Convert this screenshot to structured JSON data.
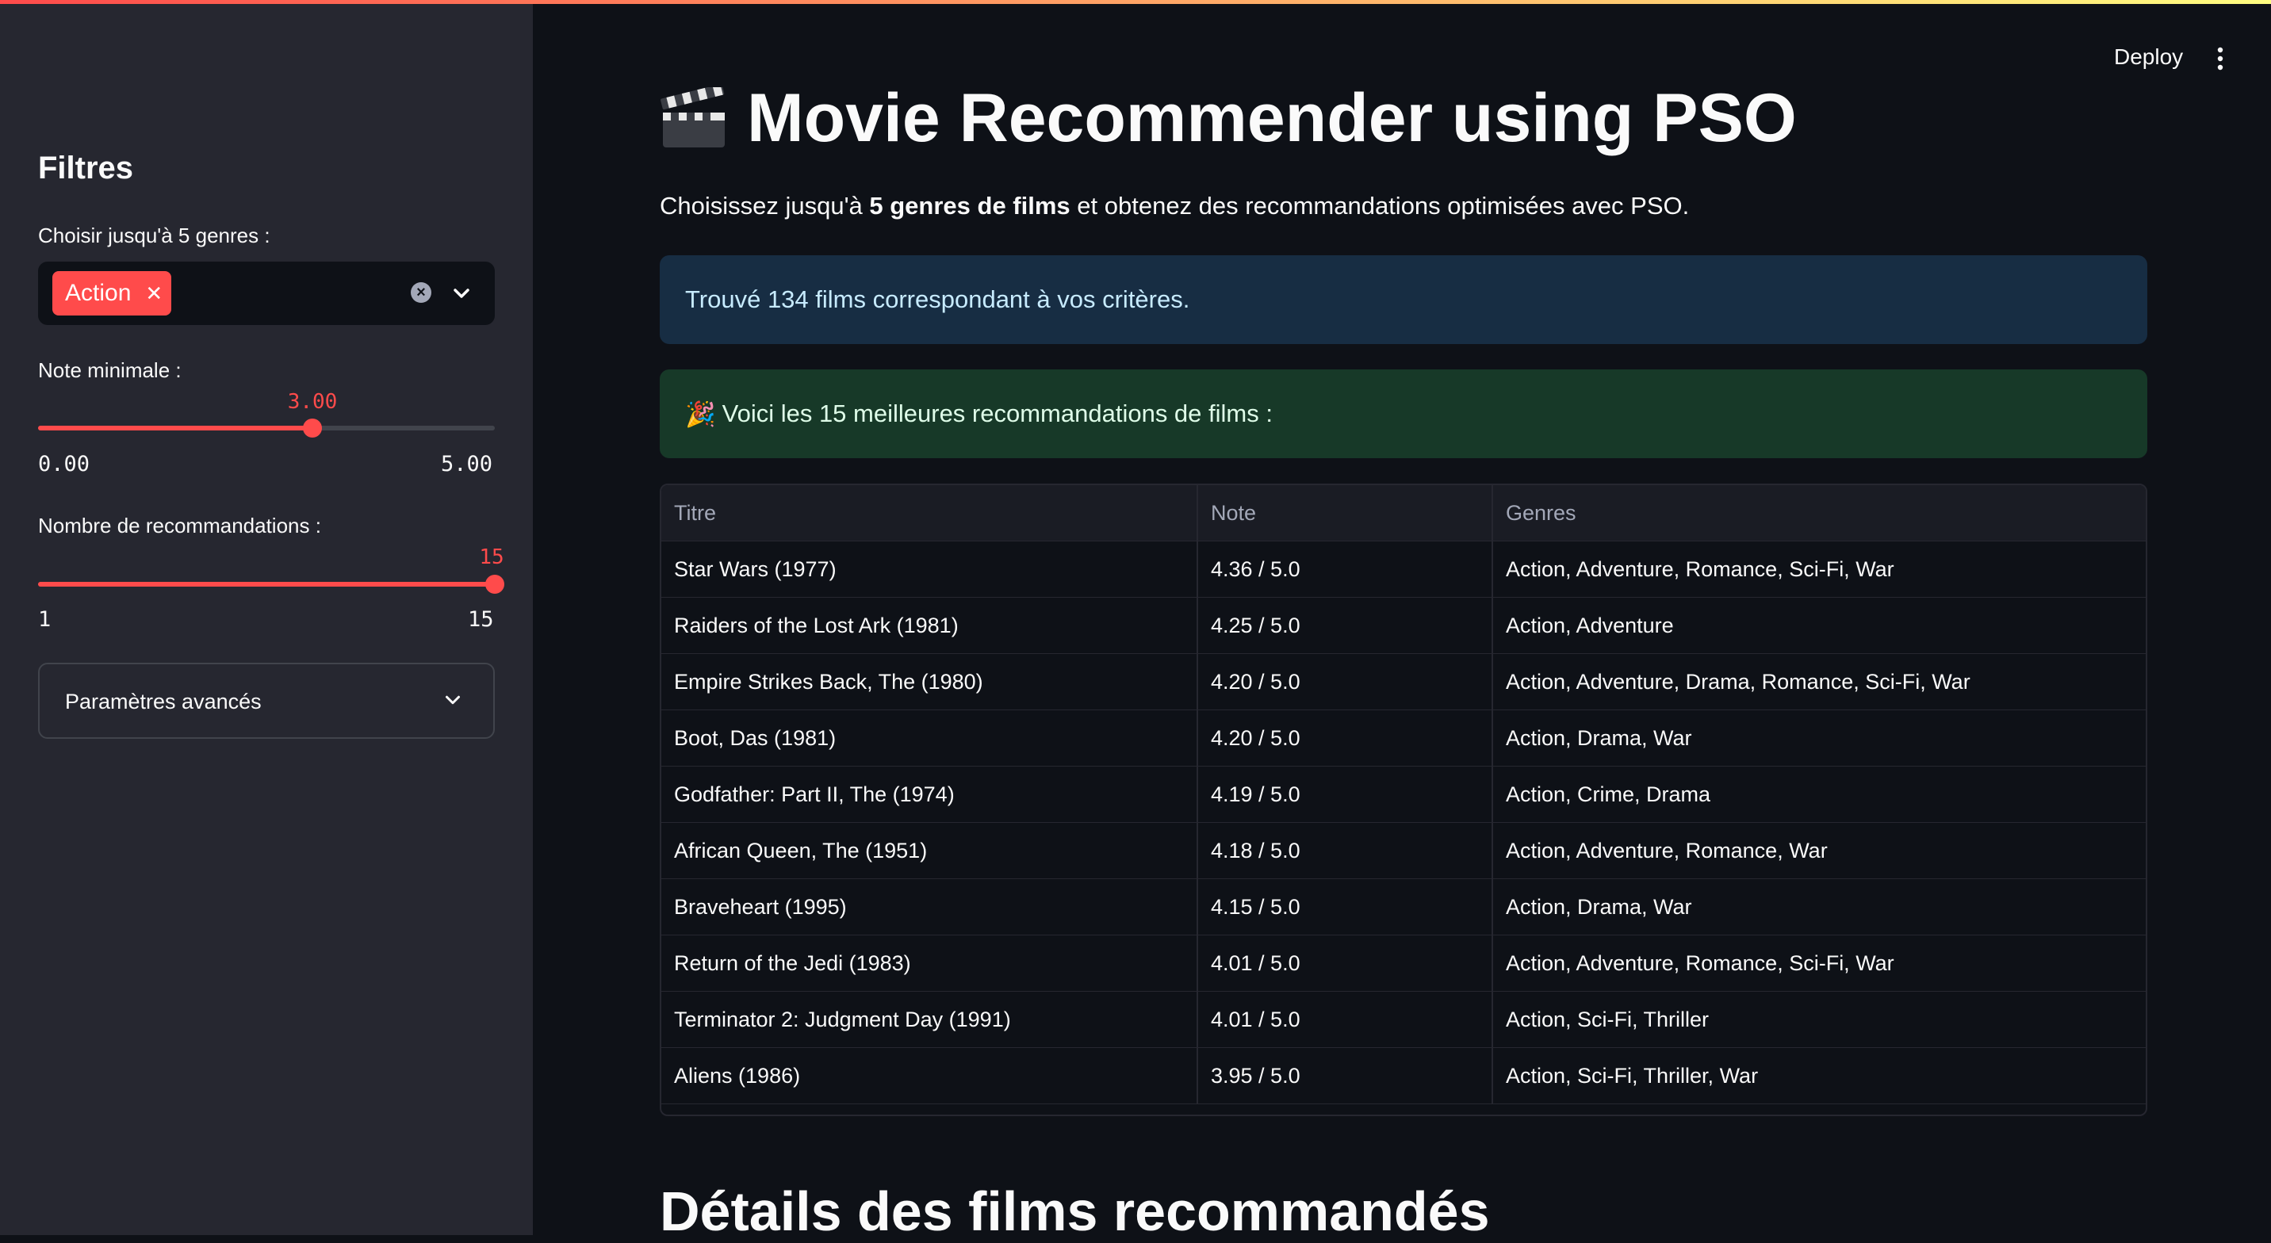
{
  "header": {
    "deploy_label": "Deploy"
  },
  "sidebar": {
    "title": "Filtres",
    "genres": {
      "label": "Choisir jusqu'à 5 genres :",
      "selected": [
        "Action"
      ]
    },
    "min_rating": {
      "label": "Note minimale :",
      "value": 3.0,
      "value_text": "3.00",
      "min_text": "0.00",
      "max_text": "5.00",
      "fraction": 0.6
    },
    "num_recs": {
      "label": "Nombre de recommandations :",
      "value": 15,
      "value_text": "15",
      "min_text": "1",
      "max_text": "15",
      "fraction": 1.0
    },
    "advanced": {
      "label": "Paramètres avancés"
    }
  },
  "main": {
    "title": "Movie Recommender using PSO",
    "intro_prefix": "Choisissez jusqu'à ",
    "intro_bold": "5 genres de films",
    "intro_suffix": " et obtenez des recommandations optimisées avec PSO.",
    "info_message": "Trouvé 134 films correspondant à vos critères.",
    "success_message": "Voici les 15 meilleures recommandations de films :",
    "section_title": "Détails des films recommandés"
  },
  "table": {
    "headers": [
      "Titre",
      "Note",
      "Genres"
    ],
    "rows": [
      [
        "Star Wars (1977)",
        "4.36 / 5.0",
        "Action, Adventure, Romance, Sci-Fi, War"
      ],
      [
        "Raiders of the Lost Ark (1981)",
        "4.25 / 5.0",
        "Action, Adventure"
      ],
      [
        "Empire Strikes Back, The (1980)",
        "4.20 / 5.0",
        "Action, Adventure, Drama, Romance, Sci-Fi, War"
      ],
      [
        "Boot, Das (1981)",
        "4.20 / 5.0",
        "Action, Drama, War"
      ],
      [
        "Godfather: Part II, The (1974)",
        "4.19 / 5.0",
        "Action, Crime, Drama"
      ],
      [
        "African Queen, The (1951)",
        "4.18 / 5.0",
        "Action, Adventure, Romance, War"
      ],
      [
        "Braveheart (1995)",
        "4.15 / 5.0",
        "Action, Drama, War"
      ],
      [
        "Return of the Jedi (1983)",
        "4.01 / 5.0",
        "Action, Adventure, Romance, Sci-Fi, War"
      ],
      [
        "Terminator 2: Judgment Day (1991)",
        "4.01 / 5.0",
        "Action, Sci-Fi, Thriller"
      ],
      [
        "Aliens (1986)",
        "3.95 / 5.0",
        "Action, Sci-Fi, Thriller, War"
      ]
    ]
  },
  "colors": {
    "accent": "#ff4b4b",
    "info_bg": "#172d43",
    "success_bg": "#173928",
    "sidebar_bg": "#262730",
    "app_bg": "#0e1117"
  },
  "icons": {
    "title": "clapperboard-icon",
    "success": "party-popper-icon",
    "tag_remove": "close-icon",
    "clear": "clear-icon",
    "dropdown": "chevron-down-icon",
    "menu": "vertical-dots-icon"
  }
}
